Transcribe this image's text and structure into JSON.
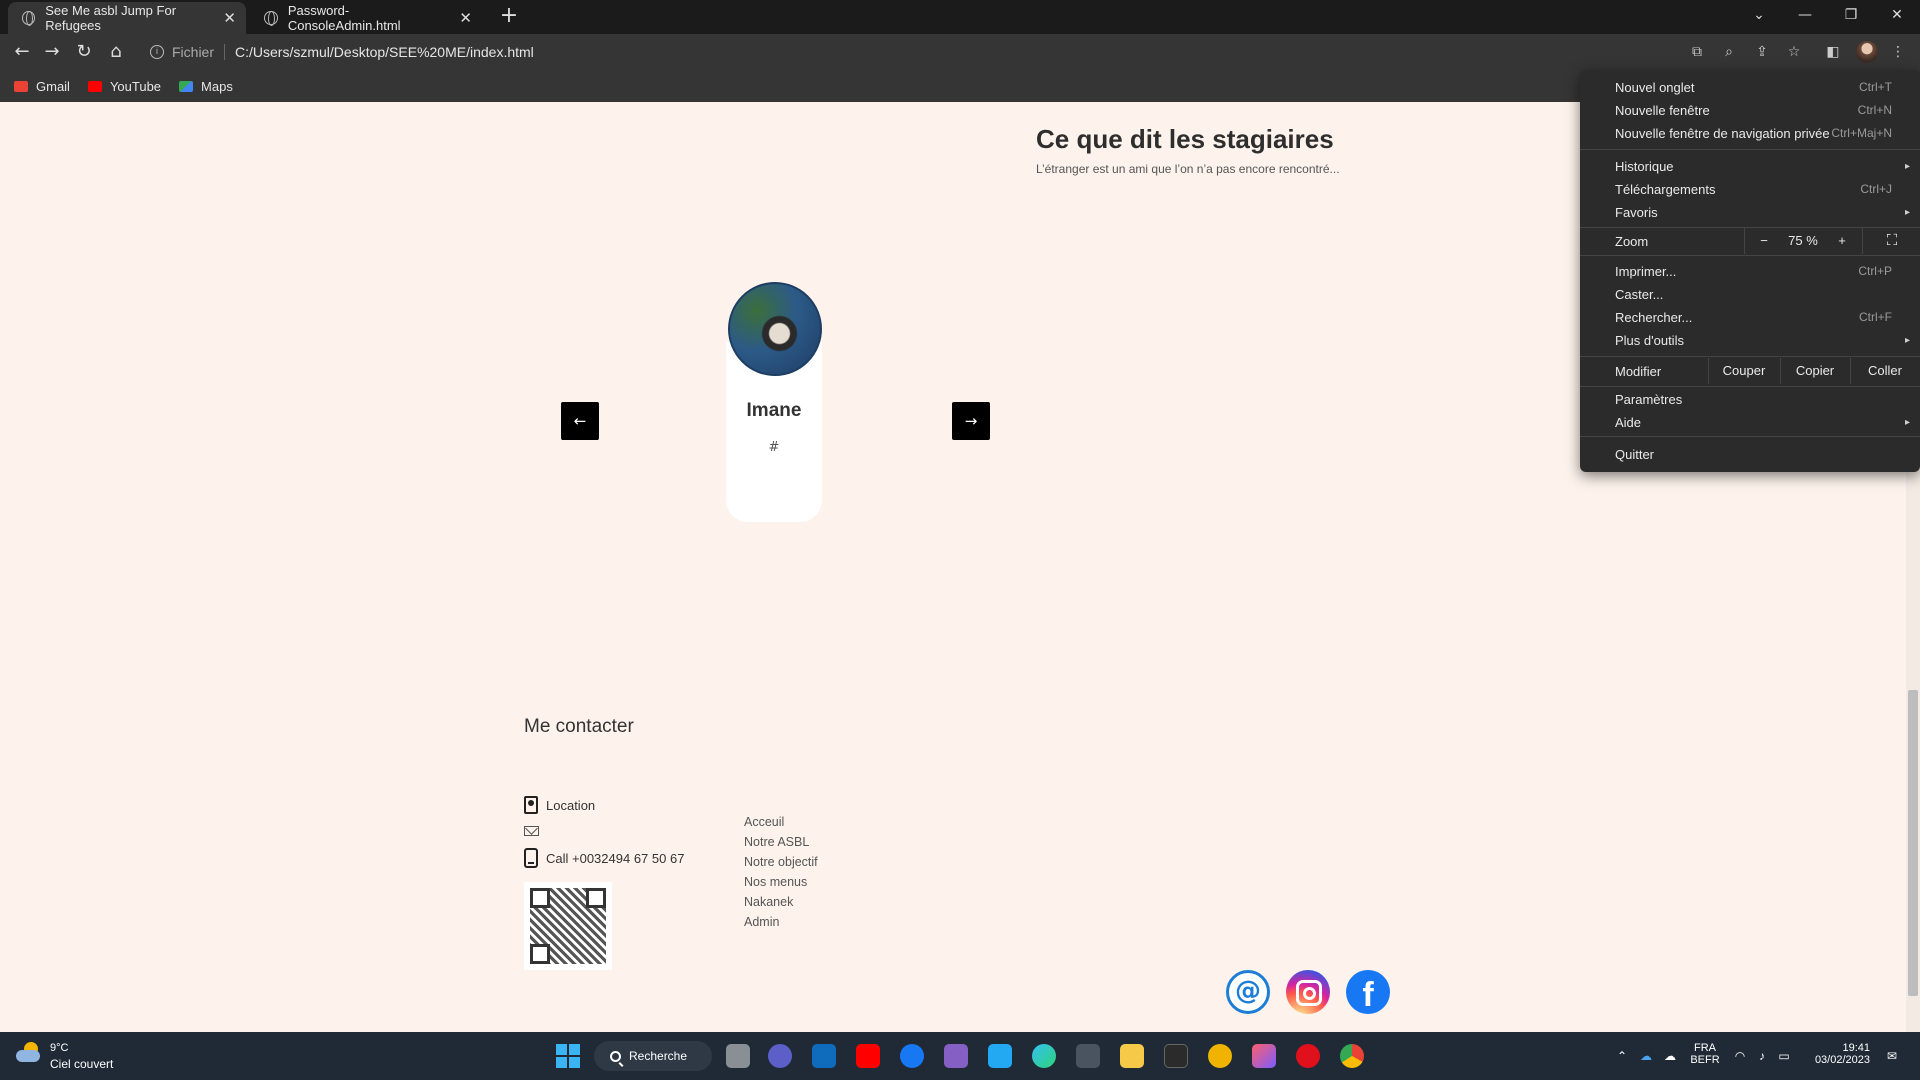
{
  "browser": {
    "tabs": [
      {
        "title": "See Me asbl Jump For Refugees",
        "close": "✕"
      },
      {
        "title": "Password-ConsoleAdmin.html",
        "close": "✕"
      }
    ],
    "new_tab": "+",
    "window_controls": {
      "list": "⌄",
      "minimize": "—",
      "restore": "❐",
      "close": "✕"
    },
    "address": {
      "scheme": "Fichier",
      "url": "C:/Users/szmul/Desktop/SEE%20ME/index.html"
    },
    "bookmarks": [
      {
        "label": "Gmail",
        "color": "#ea4335"
      },
      {
        "label": "YouTube",
        "color": "#ff0000"
      },
      {
        "label": "Maps",
        "color": "#34a853"
      }
    ]
  },
  "testimonials": {
    "title": "Ce que dit les stagiaires",
    "subtitle": "L’étranger est un ami que l’on n’a pas encore rencontré...",
    "card": {
      "name": "Imane",
      "role": "#"
    },
    "prev": "←",
    "next": "→"
  },
  "contact": {
    "title": "Me contacter",
    "location": "Location",
    "phone": "Call +0032494 67 50 67"
  },
  "footer_links": [
    "Acceuil",
    "Notre ASBL",
    "Notre objectif",
    "Nos menus",
    "Nakanek",
    "Admin"
  ],
  "social": {
    "at": "@",
    "facebook": "f"
  },
  "menu": {
    "items_top": [
      {
        "label": "Nouvel onglet",
        "shortcut": "Ctrl+T"
      },
      {
        "label": "Nouvelle fenêtre",
        "shortcut": "Ctrl+N"
      },
      {
        "label": "Nouvelle fenêtre de navigation privée",
        "shortcut": "Ctrl+Maj+N"
      }
    ],
    "items_mid": [
      {
        "label": "Historique",
        "sub": "▸"
      },
      {
        "label": "Téléchargements",
        "shortcut": "Ctrl+J"
      },
      {
        "label": "Favoris",
        "sub": "▸"
      }
    ],
    "zoom": {
      "label": "Zoom",
      "minus": "−",
      "value": "75 %",
      "plus": "+",
      "fullscreen": "⛶"
    },
    "items_tools": [
      {
        "label": "Imprimer...",
        "shortcut": "Ctrl+P"
      },
      {
        "label": "Caster..."
      },
      {
        "label": "Rechercher...",
        "shortcut": "Ctrl+F"
      },
      {
        "label": "Plus d'outils",
        "sub": "▸"
      }
    ],
    "edit": {
      "label": "Modifier",
      "cut": "Couper",
      "copy": "Copier",
      "paste": "Coller"
    },
    "items_bottom": [
      {
        "label": "Paramètres"
      },
      {
        "label": "Aide",
        "sub": "▸"
      }
    ],
    "quit": "Quitter"
  },
  "taskbar": {
    "weather": {
      "temp": "9°C",
      "desc": "Ciel couvert"
    },
    "search": "Recherche",
    "lang": {
      "l1": "FRA",
      "l2": "BEFR"
    },
    "time": "19:41",
    "date": "03/02/2023"
  }
}
